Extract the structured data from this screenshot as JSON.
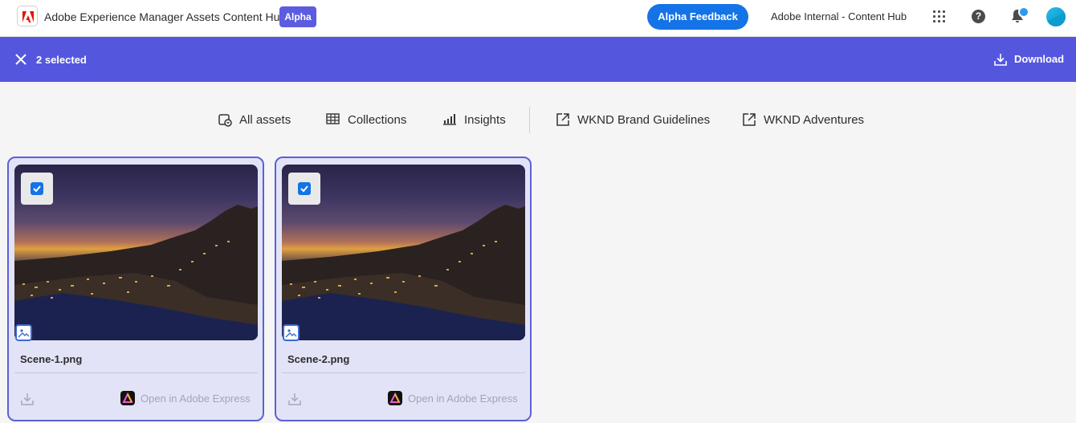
{
  "header": {
    "app_title": "Adobe Experience Manager Assets Content Hub",
    "badge": "Alpha",
    "feedback_label": "Alpha Feedback",
    "org_name": "Adobe Internal - Content Hub",
    "help_glyph": "?",
    "icons": [
      "adobe-logo-icon",
      "app-switcher-icon",
      "help-icon",
      "notification-bell-icon",
      "avatar"
    ],
    "accent_color": "#1473e6"
  },
  "selection_bar": {
    "count_label": "2 selected",
    "download_label": "Download",
    "background_color": "#5457de"
  },
  "nav": {
    "items": [
      {
        "label": "All assets",
        "icon": "all-assets-icon"
      },
      {
        "label": "Collections",
        "icon": "collections-grid-icon"
      },
      {
        "label": "Insights",
        "icon": "insights-bar-icon"
      },
      {
        "label": "WKND Brand Guidelines",
        "icon": "external-link-icon"
      },
      {
        "label": "WKND Adventures",
        "icon": "external-link-icon"
      }
    ]
  },
  "assets": [
    {
      "name": "Scene-1.png",
      "selected": true,
      "type_icon": "image-icon",
      "action_label": "Open in Adobe Express"
    },
    {
      "name": "Scene-2.png",
      "selected": true,
      "type_icon": "image-icon",
      "action_label": "Open in Adobe Express"
    }
  ]
}
